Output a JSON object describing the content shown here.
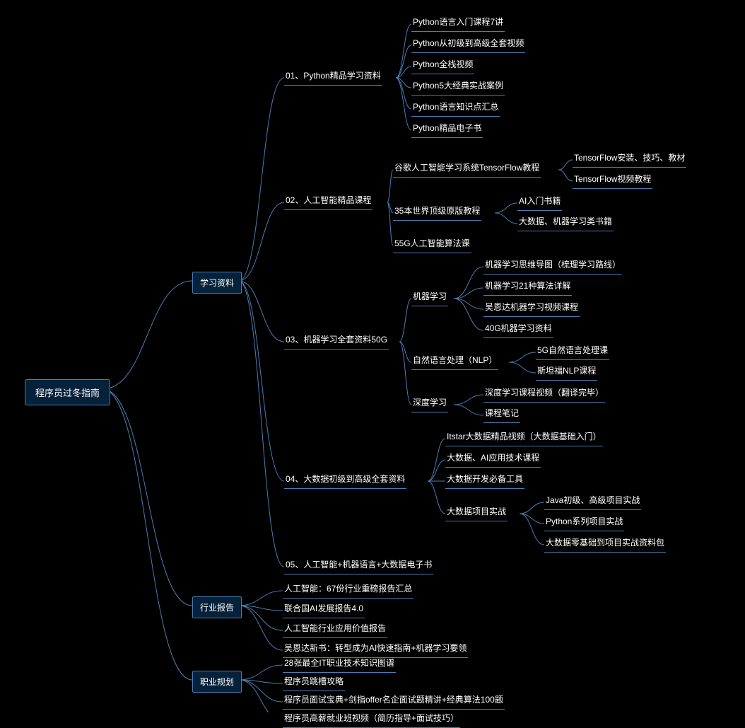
{
  "root": "程序员过冬指南",
  "styles": {
    "link_stroke": "#4a7db5",
    "box_stroke": "#4a7db5",
    "box_fill": "#06223b"
  },
  "branches": [
    {
      "key": "study",
      "label": "学习资料",
      "children": [
        {
          "label": "01、Python精品学习资料",
          "children": [
            {
              "label": "Python语言入门课程7讲"
            },
            {
              "label": "Python从初级到高级全套视频"
            },
            {
              "label": "Python全栈视频"
            },
            {
              "label": "Python5大经典实战案例"
            },
            {
              "label": "Python语言知识点汇总"
            },
            {
              "label": "Python精品电子书"
            }
          ]
        },
        {
          "label": "02、人工智能精品课程",
          "children": [
            {
              "label": "谷歌人工智能学习系统TensorFlow教程",
              "children": [
                {
                  "label": "TensorFlow安装、技巧、教材"
                },
                {
                  "label": "TensorFlow视频教程"
                }
              ]
            },
            {
              "label": "35本世界顶级原版教程",
              "children": [
                {
                  "label": "AI入门书籍"
                },
                {
                  "label": "大数据、机器学习类书籍"
                }
              ]
            },
            {
              "label": "55G人工智能算法课"
            }
          ]
        },
        {
          "label": "03、机器学习全套资料50G",
          "children": [
            {
              "label": "机器学习",
              "children": [
                {
                  "label": "机器学习思维导图（梳理学习路线）"
                },
                {
                  "label": "机器学习21种算法详解"
                },
                {
                  "label": "吴恩达机器学习视频课程"
                },
                {
                  "label": "40G机器学习资料"
                }
              ]
            },
            {
              "label": "自然语言处理（NLP）",
              "children": [
                {
                  "label": "5G自然语言处理课"
                },
                {
                  "label": "斯坦福NLP课程"
                }
              ]
            },
            {
              "label": "深度学习",
              "children": [
                {
                  "label": "深度学习课程视频（翻译完毕）"
                },
                {
                  "label": "课程笔记"
                }
              ]
            }
          ]
        },
        {
          "label": "04、大数据初级到高级全套资料",
          "children": [
            {
              "label": "Itstar大数据精品视频（大数据基础入门）"
            },
            {
              "label": "大数据、AI应用技术课程"
            },
            {
              "label": "大数据开发必备工具"
            },
            {
              "label": "大数据项目实战",
              "children": [
                {
                  "label": "Java初级、高级项目实战"
                },
                {
                  "label": "Python系列项目实战"
                },
                {
                  "label": "大数据零基础到项目实战资料包"
                }
              ]
            }
          ]
        },
        {
          "label": "05、人工智能+机器语言+大数据电子书"
        }
      ]
    },
    {
      "key": "report",
      "label": "行业报告",
      "children": [
        {
          "label": "人工智能：67份行业重磅报告汇总"
        },
        {
          "label": "联合国AI发展报告4.0"
        },
        {
          "label": "人工智能行业应用价值报告"
        },
        {
          "label": "吴恩达新书：转型成为AI快速指南+机器学习要领"
        }
      ]
    },
    {
      "key": "career",
      "label": "职业规划",
      "children": [
        {
          "label": "28张最全IT职业技术知识图谱"
        },
        {
          "label": "程序员跳槽攻略"
        },
        {
          "label": "程序员面试宝典+剑指offer名企面试题精讲+经典算法100题"
        },
        {
          "label": "程序员高薪就业班视频（简历指导+面试技巧）"
        }
      ]
    }
  ]
}
